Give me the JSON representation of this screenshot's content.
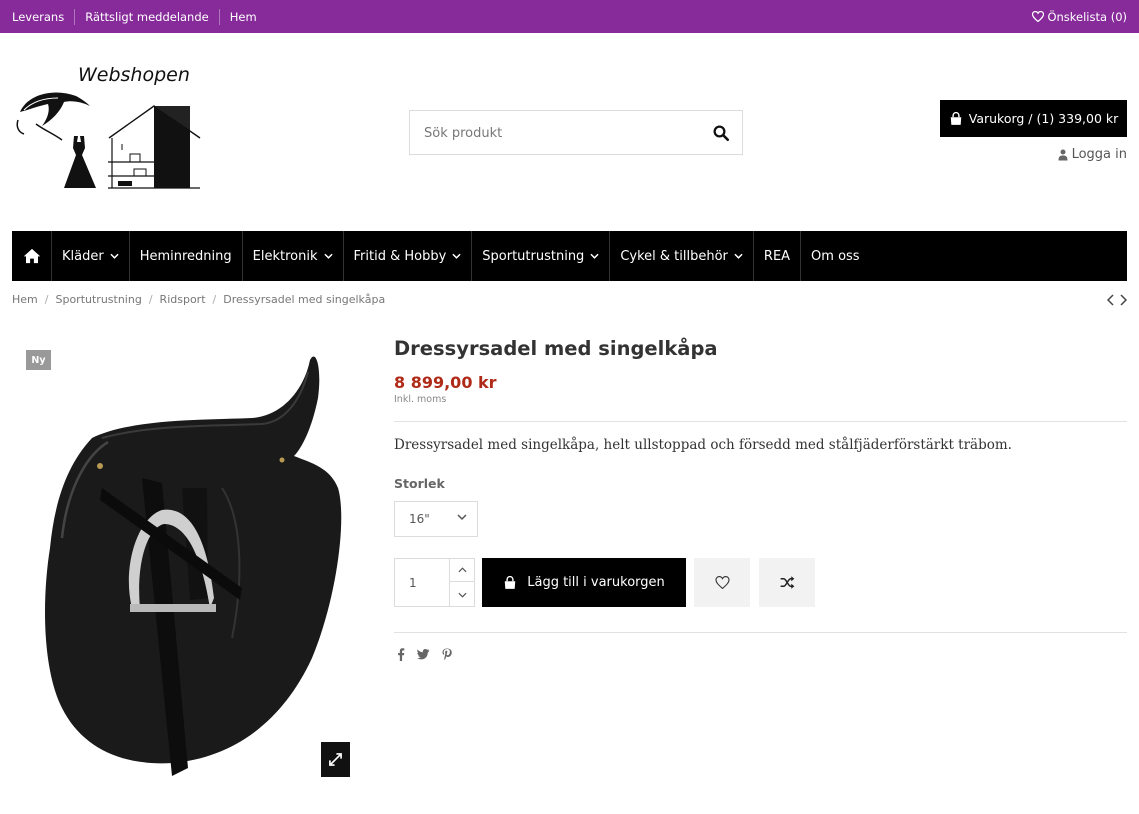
{
  "topbar": {
    "links": [
      "Leverans",
      "Rättsligt meddelande",
      "Hem"
    ],
    "wishlist_label": "Önskelista (0)",
    "bg_color": "#872b9b"
  },
  "header": {
    "logo_text": "Webshopen",
    "search_placeholder": "Sök produkt",
    "cart_label": "Varukorg / (1) 339,00 kr",
    "login_label": "Logga in"
  },
  "nav": {
    "items": [
      {
        "label": "Kläder",
        "has_dropdown": true
      },
      {
        "label": "Heminredning",
        "has_dropdown": false
      },
      {
        "label": "Elektronik",
        "has_dropdown": true
      },
      {
        "label": "Fritid & Hobby",
        "has_dropdown": true
      },
      {
        "label": "Sportutrustning",
        "has_dropdown": true
      },
      {
        "label": "Cykel & tillbehör",
        "has_dropdown": true
      },
      {
        "label": "REA",
        "has_dropdown": false
      },
      {
        "label": "Om oss",
        "has_dropdown": false
      }
    ]
  },
  "breadcrumb": [
    "Hem",
    "Sportutrustning",
    "Ridsport",
    "Dressyrsadel med singelkåpa"
  ],
  "product": {
    "badge": "Ny",
    "title": "Dressyrsadel med singelkåpa",
    "price": "8 899,00 kr",
    "tax_note": "Inkl. moms",
    "description": "Dressyrsadel med singelkåpa, helt ullstoppad och försedd med stålfjäderförstärkt träbom.",
    "size_label": "Storlek",
    "size_value": "16\"",
    "quantity": "1",
    "add_to_cart_label": "Lägg till i varukorgen",
    "price_color": "#b02a18"
  },
  "icons": {
    "home": "home-icon",
    "search": "search-icon",
    "cart": "shopping-bag-icon",
    "user": "user-icon",
    "heart": "heart-icon",
    "compare": "shuffle-icon",
    "expand": "expand-icon",
    "facebook": "facebook-icon",
    "twitter": "twitter-icon",
    "pinterest": "pinterest-icon"
  }
}
